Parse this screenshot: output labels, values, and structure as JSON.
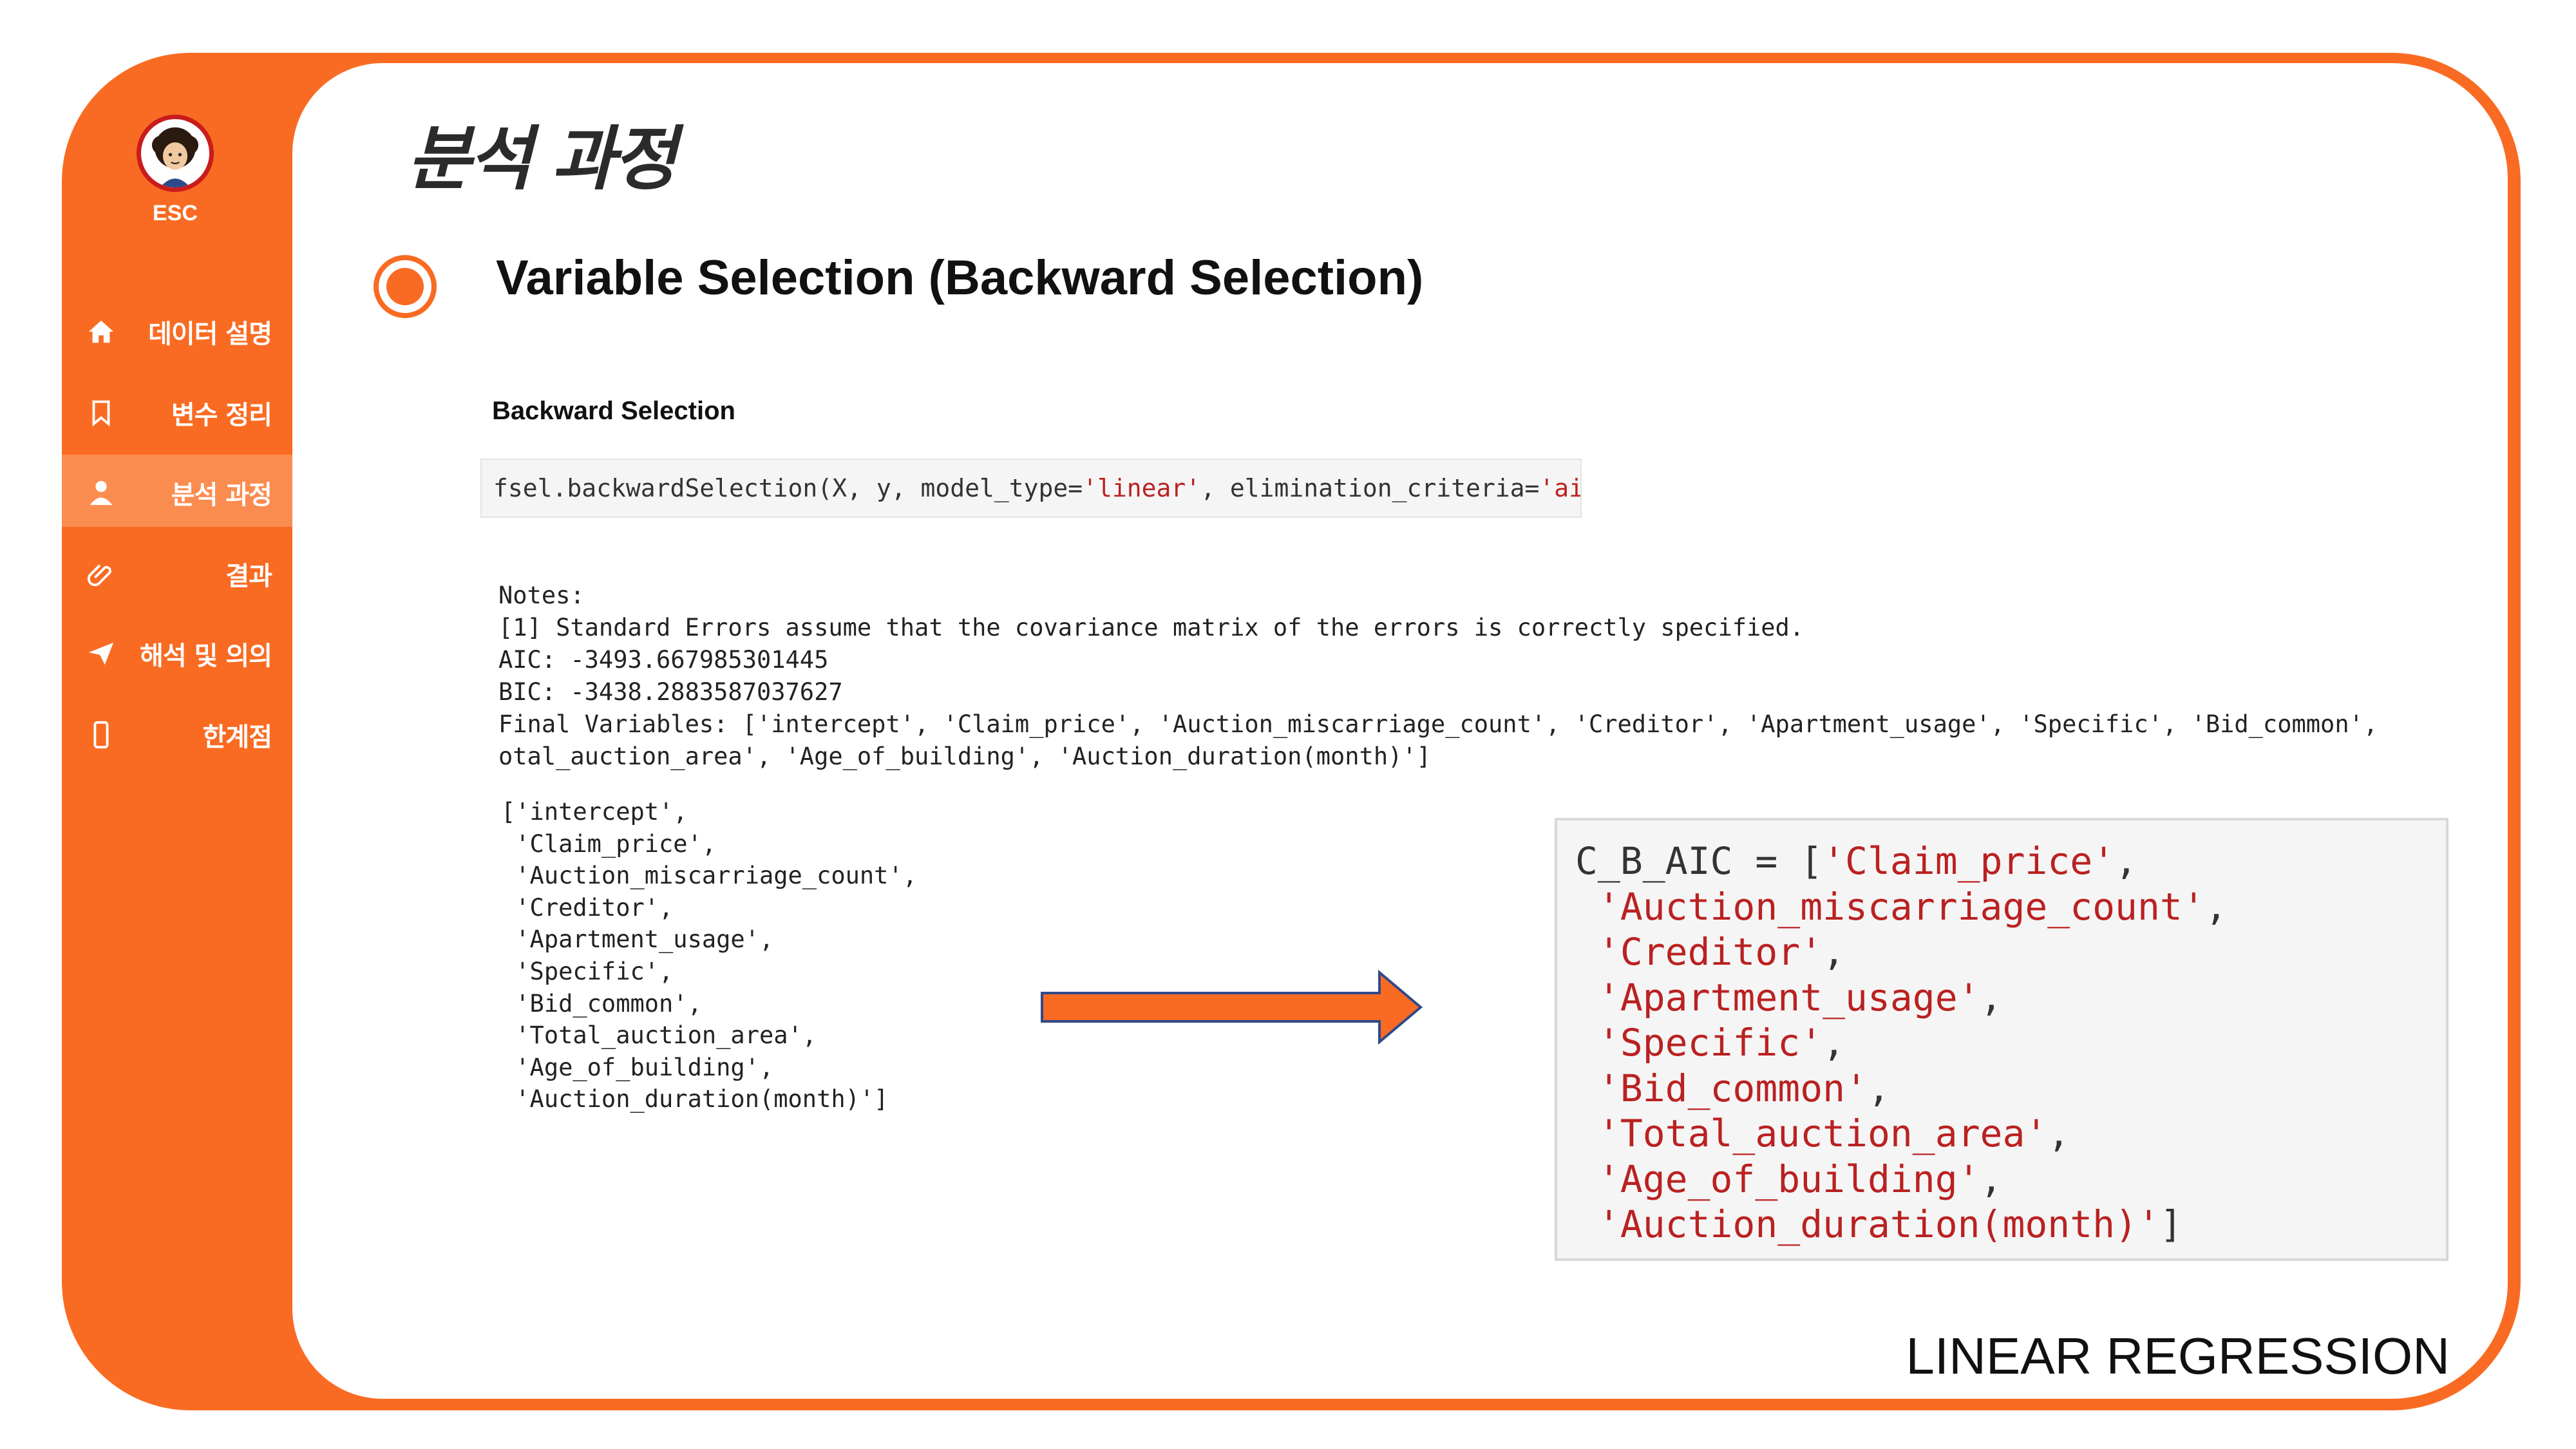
{
  "brand": {
    "name": "ESC"
  },
  "sidebar": {
    "items": [
      {
        "label": "데이터 설명",
        "icon": "home-icon",
        "active": false
      },
      {
        "label": "변수 정리",
        "icon": "bookmark-icon",
        "active": false
      },
      {
        "label": "분석 과정",
        "icon": "user-icon",
        "active": true
      },
      {
        "label": "결과",
        "icon": "paperclip-icon",
        "active": false
      },
      {
        "label": "해석 및 의의",
        "icon": "send-icon",
        "active": false
      },
      {
        "label": "한계점",
        "icon": "mobile-icon",
        "active": false
      }
    ]
  },
  "main": {
    "title": "분석 과정",
    "section_title": "Variable Selection (Backward Selection)",
    "sub_heading": "Backward Selection",
    "code": {
      "prefix": "fsel.backwardSelection(X, y, model_type=",
      "model_type": "'linear'",
      "middle": ", elimination_criteria=",
      "criteria": "'aic'",
      "suffix": ")"
    },
    "notes": [
      "Notes:",
      "[1] Standard Errors assume that the covariance matrix of the errors is correctly specified.",
      "AIC: -3493.667985301445",
      "BIC: -3438.2883587037627",
      "Final Variables: ['intercept', 'Claim_price', 'Auction_miscarriage_count', 'Creditor', 'Apartment_usage', 'Specific', 'Bid_common',",
      "otal_auction_area', 'Age_of_building', 'Auction_duration(month)']"
    ],
    "list_output": [
      "['intercept',",
      " 'Claim_price',",
      " 'Auction_miscarriage_count',",
      " 'Creditor',",
      " 'Apartment_usage',",
      " 'Specific',",
      " 'Bid_common',",
      " 'Total_auction_area',",
      " 'Age_of_building',",
      " 'Auction_duration(month)']"
    ],
    "result": {
      "var_name": "C_B_AIC = [",
      "items": [
        "'Claim_price'",
        "'Auction_miscarriage_count'",
        "'Creditor'",
        "'Apartment_usage'",
        "'Specific'",
        "'Bid_common'",
        "'Total_auction_area'",
        "'Age_of_building'",
        "'Auction_duration(month)'"
      ]
    }
  },
  "footer": {
    "label": "LINEAR REGRESSION"
  },
  "colors": {
    "accent": "#f96b22",
    "string": "#ba2121",
    "arrow_border": "#2f4a8a"
  }
}
